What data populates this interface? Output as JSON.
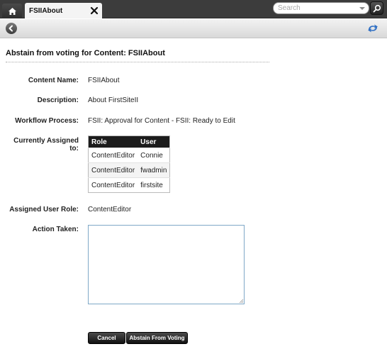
{
  "tabbar": {
    "tab_label": "FSIIAbout",
    "search_placeholder": "Search"
  },
  "page": {
    "title": "Abstain from voting for Content: FSIIAbout"
  },
  "fields": {
    "content_name_label": "Content Name:",
    "content_name_value": "FSIIAbout",
    "description_label": "Description:",
    "description_value": "About FirstSiteII",
    "workflow_label": "Workflow Process:",
    "workflow_value": "FSII: Approval for Content - FSII: Ready to Edit",
    "assigned_label": "Currently Assigned to:",
    "role_label": "Assigned User Role:",
    "role_value": "ContentEditor",
    "action_label": "Action Taken:",
    "action_value": ""
  },
  "assigned_table": {
    "headers": {
      "role": "Role",
      "user": "User"
    },
    "rows": [
      {
        "role": "ContentEditor",
        "user": "Connie"
      },
      {
        "role": "ContentEditor",
        "user": "fwadmin"
      },
      {
        "role": "ContentEditor",
        "user": "firstsite"
      }
    ]
  },
  "buttons": {
    "cancel": "Cancel",
    "abstain": "Abstain From Voting"
  },
  "icons": {
    "home": "home-icon",
    "close": "close-icon",
    "search": "search-icon",
    "back": "back-arrow-icon",
    "sync": "sync-icon"
  },
  "colors": {
    "accent_blue": "#3a7bd5",
    "dark_button": "#1c1c1c"
  }
}
